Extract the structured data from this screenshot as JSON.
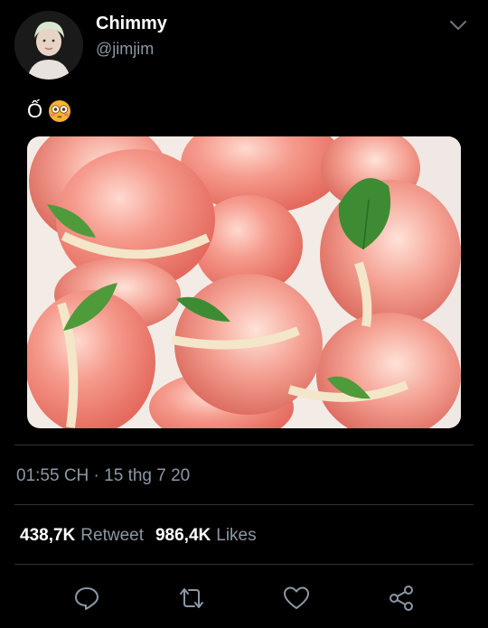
{
  "author": {
    "display_name": "Chimmy",
    "handle": "@jimjim"
  },
  "tweet": {
    "text": "Ố"
  },
  "meta": {
    "timestamp": "01:55 CH · 15 thg 7 20"
  },
  "stats": {
    "retweets_count": "438,7K",
    "retweets_label": "Retweet",
    "likes_count": "986,4K",
    "likes_label": "Likes"
  },
  "icons": {
    "reply": "comment-icon",
    "retweet": "retweet-icon",
    "like": "heart-icon",
    "share": "share-icon",
    "more": "chevron-down-icon",
    "emoji": "flushed-face-emoji"
  },
  "colors": {
    "background": "#000000",
    "primary_text": "#ffffff",
    "secondary_text": "#8b98a5",
    "divider": "#2f3336"
  }
}
